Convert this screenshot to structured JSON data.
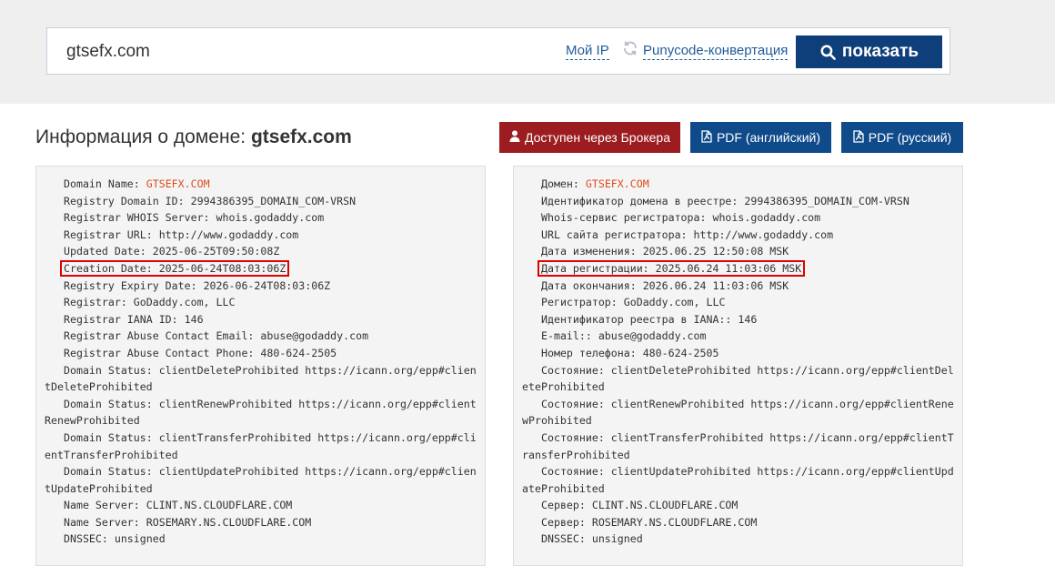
{
  "search": {
    "value": "gtsefx.com",
    "my_ip_label": "Мой IP",
    "refresh_icon": "refresh-icon",
    "punycode_label": "Punycode-конвертация",
    "show_button_label": "показать",
    "accent": "#0f3f7a"
  },
  "header": {
    "title_prefix": "Информация о домене:",
    "title_domain": "gtsefx.com"
  },
  "actions": {
    "broker_label": "Доступен через Брокера",
    "pdf_en_label": "PDF (английский)",
    "pdf_ru_label": "PDF (русский)",
    "broker_color": "#9c1c1f",
    "pdf_color": "#0f4a8a"
  },
  "whois_en": [
    {
      "key": "Domain Name: ",
      "value": "GTSEFX.COM",
      "orange": true
    },
    {
      "key": "Registry Domain ID: ",
      "value": "2994386395_DOMAIN_COM-VRSN"
    },
    {
      "key": "Registrar WHOIS Server: ",
      "value": "whois.godaddy.com"
    },
    {
      "key": "Registrar URL: ",
      "value": "http://www.godaddy.com"
    },
    {
      "key": "Updated Date: ",
      "value": "2025-06-25T09:50:08Z"
    },
    {
      "key": "Creation Date: ",
      "value": "2025-06-24T08:03:06Z",
      "highlight": true
    },
    {
      "key": "Registry Expiry Date: ",
      "value": "2026-06-24T08:03:06Z"
    },
    {
      "key": "Registrar: ",
      "value": "GoDaddy.com, LLC"
    },
    {
      "key": "Registrar IANA ID: ",
      "value": "146"
    },
    {
      "key": "Registrar Abuse Contact Email: ",
      "value": "abuse@godaddy.com"
    },
    {
      "key": "Registrar Abuse Contact Phone: ",
      "value": "480-624-2505"
    },
    {
      "key": "Domain Status: ",
      "value": "clientDeleteProhibited https://icann.org/epp#clientDeleteProhibited"
    },
    {
      "key": "Domain Status: ",
      "value": "clientRenewProhibited https://icann.org/epp#clientRenewProhibited"
    },
    {
      "key": "Domain Status: ",
      "value": "clientTransferProhibited https://icann.org/epp#clientTransferProhibited"
    },
    {
      "key": "Domain Status: ",
      "value": "clientUpdateProhibited https://icann.org/epp#clientUpdateProhibited"
    },
    {
      "key": "Name Server: ",
      "value": "CLINT.NS.CLOUDFLARE.COM"
    },
    {
      "key": "Name Server: ",
      "value": "ROSEMARY.NS.CLOUDFLARE.COM"
    },
    {
      "key": "DNSSEC: ",
      "value": "unsigned"
    }
  ],
  "whois_ru": [
    {
      "key": "Домен: ",
      "value": "GTSEFX.COM",
      "orange": true
    },
    {
      "key": "Идентификатор домена в реестре: ",
      "value": "2994386395_DOMAIN_COM-VRSN"
    },
    {
      "key": "Whois-сервис регистратора: ",
      "value": "whois.godaddy.com"
    },
    {
      "key": "URL сайта регистратора: ",
      "value": "http://www.godaddy.com"
    },
    {
      "key": "Дата изменения: ",
      "value": "2025.06.25 12:50:08 MSK"
    },
    {
      "key": "Дата регистрации: ",
      "value": "2025.06.24 11:03:06 MSK",
      "highlight": true
    },
    {
      "key": "Дата окончания: ",
      "value": "2026.06.24 11:03:06 MSK"
    },
    {
      "key": "Регистратор: ",
      "value": "GoDaddy.com, LLC"
    },
    {
      "key": "Идентификатор реестра в IANA:: ",
      "value": "146"
    },
    {
      "key": "E-mail:: ",
      "value": "abuse@godaddy.com"
    },
    {
      "key": "Номер телефона: ",
      "value": "480-624-2505"
    },
    {
      "key": "Состояние: ",
      "value": "clientDeleteProhibited https://icann.org/epp#clientDeleteProhibited"
    },
    {
      "key": "Состояние: ",
      "value": "clientRenewProhibited https://icann.org/epp#clientRenewProhibited"
    },
    {
      "key": "Состояние: ",
      "value": "clientTransferProhibited https://icann.org/epp#clientTransferProhibited"
    },
    {
      "key": "Состояние: ",
      "value": "clientUpdateProhibited https://icann.org/epp#clientUpdateProhibited"
    },
    {
      "key": "Сервер: ",
      "value": "CLINT.NS.CLOUDFLARE.COM"
    },
    {
      "key": "Сервер: ",
      "value": "ROSEMARY.NS.CLOUDFLARE.COM"
    },
    {
      "key": "DNSSEC: ",
      "value": "unsigned"
    }
  ]
}
